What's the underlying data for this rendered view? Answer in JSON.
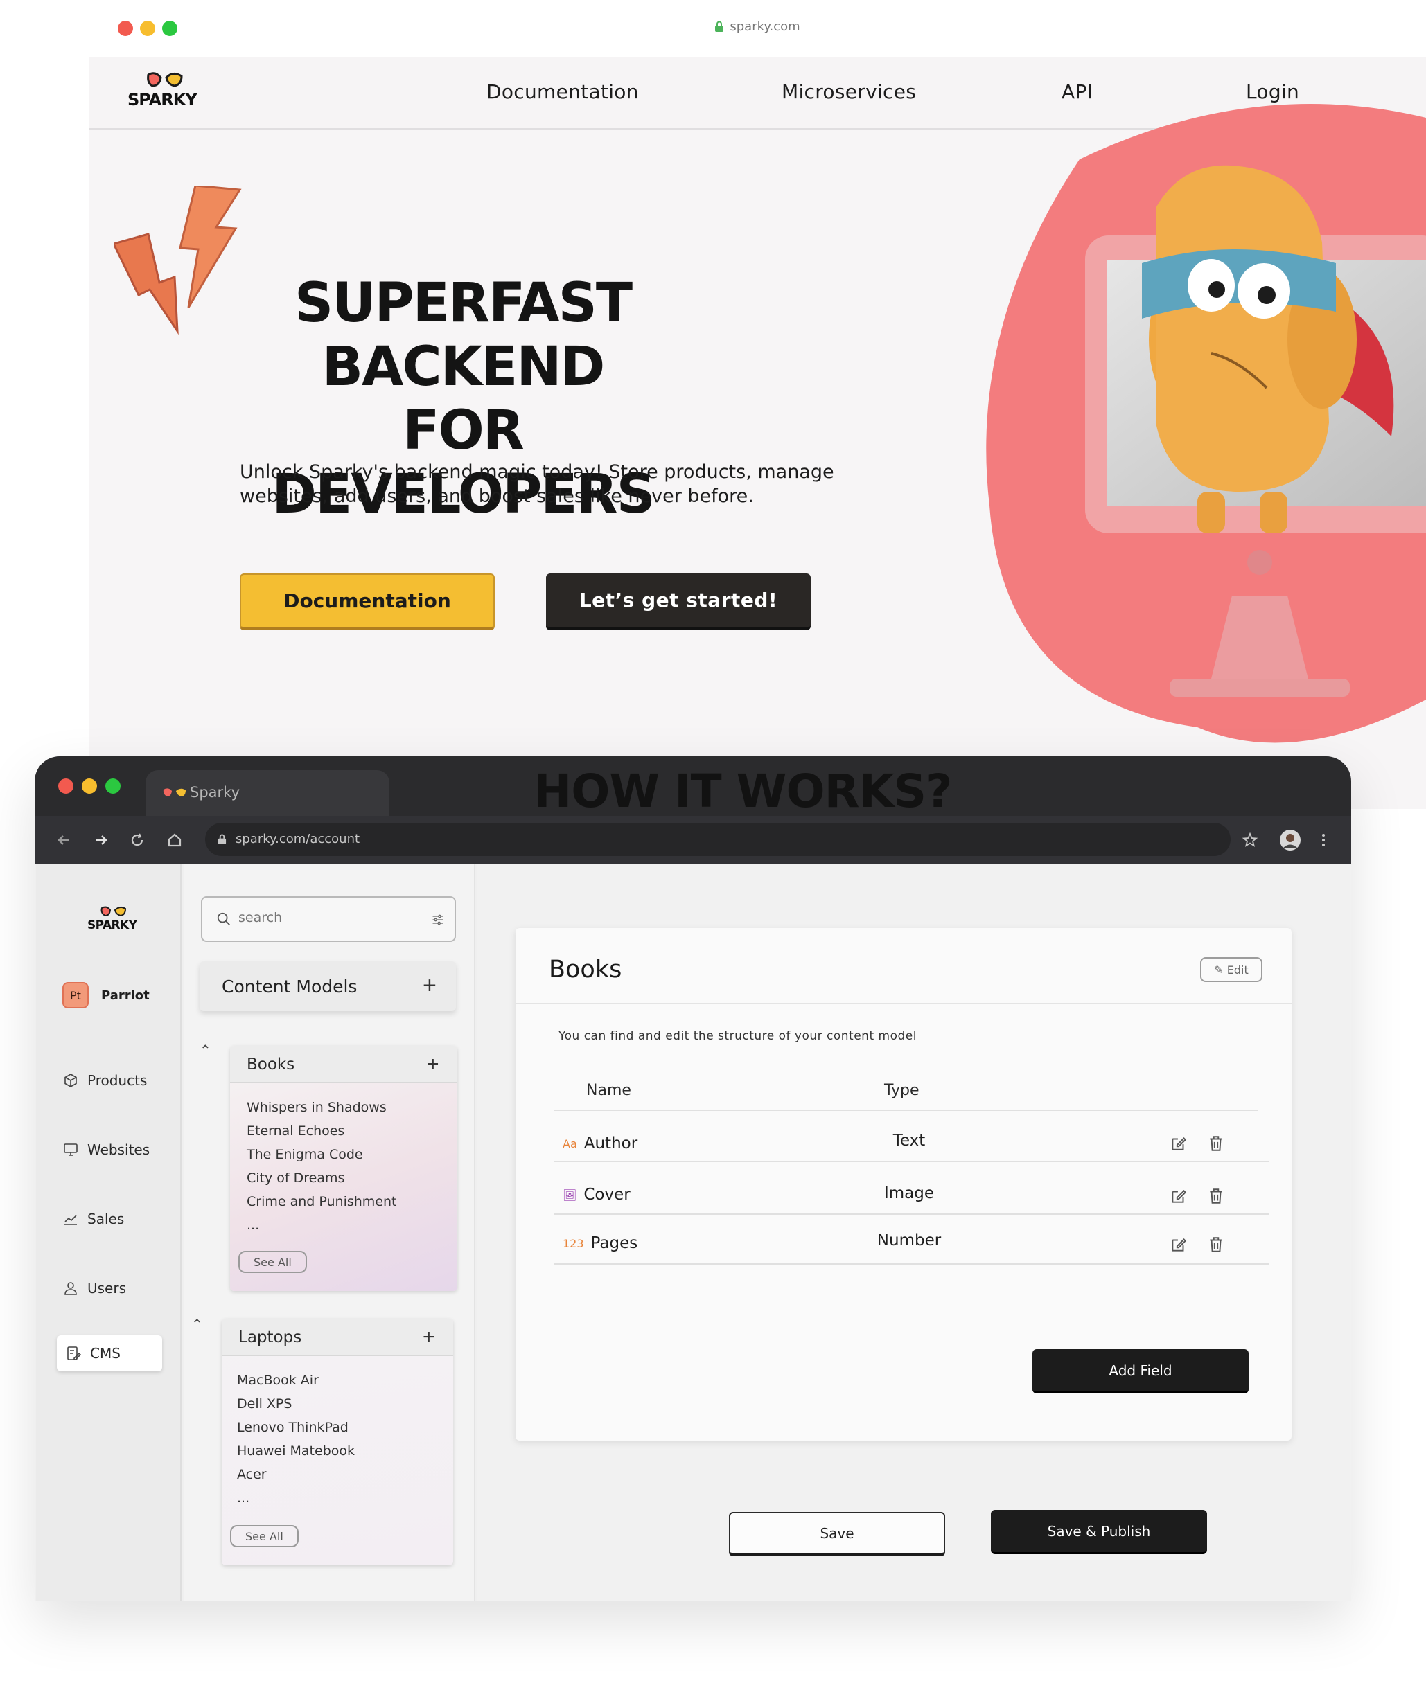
{
  "top_browser": {
    "url": "sparky.com"
  },
  "site_nav": {
    "logo_text": "SPARKY",
    "links": [
      "Documentation",
      "Microservices",
      "API",
      "Login"
    ]
  },
  "hero": {
    "title_line1": "SUPERFAST BACKEND",
    "title_line2": "FOR DEVELOPERS",
    "subtitle": "Unlock Sparky's backend magic today! Store products, manage websites, add users, and boost sales like never before.",
    "primary_button": "Documentation",
    "secondary_button": "Let’s get started!"
  },
  "section_title": "HOW IT WORKS?",
  "dashboard_browser": {
    "tab_title": "Sparky",
    "url": "sparky.com/account"
  },
  "sidebar": {
    "logo_text": "SPARKY",
    "user_initials": "Pt",
    "user_name": "Parriot",
    "items": [
      {
        "label": "Products",
        "icon": "cube-icon"
      },
      {
        "label": "Websites",
        "icon": "monitor-icon"
      },
      {
        "label": "Sales",
        "icon": "chart-icon"
      },
      {
        "label": "Users",
        "icon": "user-icon"
      },
      {
        "label": "CMS",
        "icon": "edit-doc-icon",
        "active": true
      }
    ]
  },
  "content_models": {
    "search_placeholder": "search",
    "header": "Content Models",
    "groups": [
      {
        "name": "Books",
        "items": [
          "Whispers in Shadows",
          "Eternal Echoes",
          "The Enigma Code",
          "City of Dreams",
          "Crime and Punishment",
          "..."
        ],
        "see_all": "See All"
      },
      {
        "name": "Laptops",
        "items": [
          "MacBook Air",
          "Dell XPS",
          "Lenovo ThinkPad",
          "Huawei Matebook",
          "Acer",
          "..."
        ],
        "see_all": "See All"
      }
    ]
  },
  "model_editor": {
    "title": "Books",
    "edit_label": "Edit",
    "description": "You can find and edit the structure of your content model",
    "columns": [
      "Name",
      "Type"
    ],
    "fields": [
      {
        "icon_text": "Aa",
        "name": "Author",
        "type": "Text"
      },
      {
        "icon_text": "🖼",
        "name": "Cover",
        "type": "Image"
      },
      {
        "icon_text": "123",
        "name": "Pages",
        "type": "Number"
      }
    ],
    "add_field_label": "Add Field",
    "save_label": "Save",
    "save_publish_label": "Save & Publish"
  },
  "colors": {
    "accent_yellow": "#f4be32",
    "accent_coral": "#f27b7d",
    "dark": "#1c1c1c",
    "field_icon_orange": "#e8843a",
    "field_icon_purple": "#9a3fb1"
  }
}
